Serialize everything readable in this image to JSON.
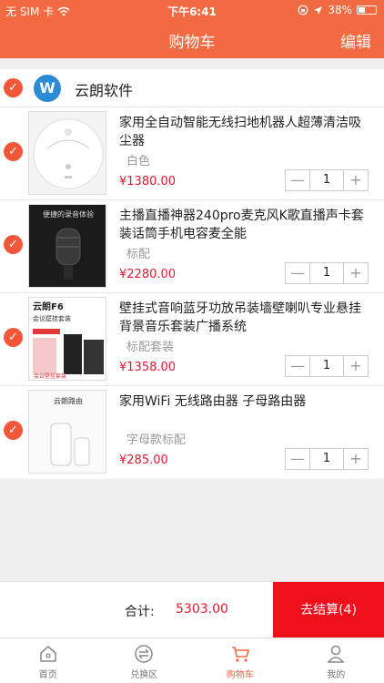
{
  "status_bar": {
    "carrier": "无 SIM 卡",
    "time": "下午6:41",
    "battery": "38%"
  },
  "nav": {
    "title": "购物车",
    "edit_label": "编辑"
  },
  "shop": {
    "name": "云朗软件",
    "logo_letter": "W"
  },
  "items": [
    {
      "name": "家用全自动智能无线扫地机器人超薄清洁吸尘器",
      "spec": "白色",
      "price": "¥1380.00",
      "quantity": "1",
      "checked": true
    },
    {
      "name": "主播直播神器240pro麦克风K歌直播声卡套装话筒手机电容麦全能",
      "spec": "标配",
      "price": "¥2280.00",
      "quantity": "1",
      "checked": true
    },
    {
      "name": "壁挂式音响蓝牙功放吊装墙壁喇叭专业悬挂背景音乐套装广播系统",
      "spec": "标配套装",
      "price": "¥1358.00",
      "quantity": "1",
      "checked": true
    },
    {
      "name": "家用WiFi 无线路由器 子母路由器",
      "spec": "字母款标配",
      "price": "¥285.00",
      "quantity": "1",
      "checked": true
    }
  ],
  "thumb_text": {
    "mic_banner": "便捷的录音体验",
    "speaker_brand": "云朗F6",
    "speaker_sub": "会议壁挂套装",
    "speaker_tag": "会议壁挂套装",
    "router_brand": "云朗路由"
  },
  "footer": {
    "total_label": "合计:",
    "total_value": "5303.00",
    "checkout_label": "去结算(4)"
  },
  "tabs": [
    {
      "label": "首页",
      "icon": "home-icon",
      "active": false
    },
    {
      "label": "兑换区",
      "icon": "exchange-icon",
      "active": false
    },
    {
      "label": "购物车",
      "icon": "cart-icon",
      "active": true
    },
    {
      "label": "我的",
      "icon": "user-icon",
      "active": false
    }
  ],
  "colors": {
    "accent": "#f26a42",
    "check": "#f2573a",
    "price": "#e6192e",
    "checkout": "#f0101c"
  }
}
